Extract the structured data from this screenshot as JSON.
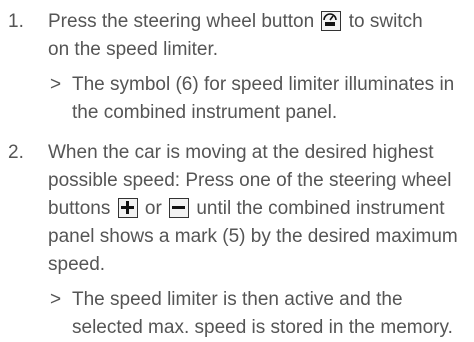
{
  "steps": [
    {
      "number": "1.",
      "before_icon": "Press the steering wheel button",
      "icon": "speed-limiter-icon",
      "after_icon": "to switch on the speed limiter.",
      "result": "The symbol (6) for speed limiter illuminates in the combined instrument panel."
    },
    {
      "number": "2.",
      "text_a": "When the car is moving at the desired highest possible speed: Press one of the steering wheel buttons",
      "icon_plus": "plus-icon",
      "text_or": "or",
      "icon_minus": "minus-icon",
      "text_b": "until the combined instrument panel shows a mark (5) by the desired maximum speed.",
      "result": "The speed limiter is then active and the selected max. speed is stored in the memory."
    }
  ],
  "result_symbol": ">"
}
